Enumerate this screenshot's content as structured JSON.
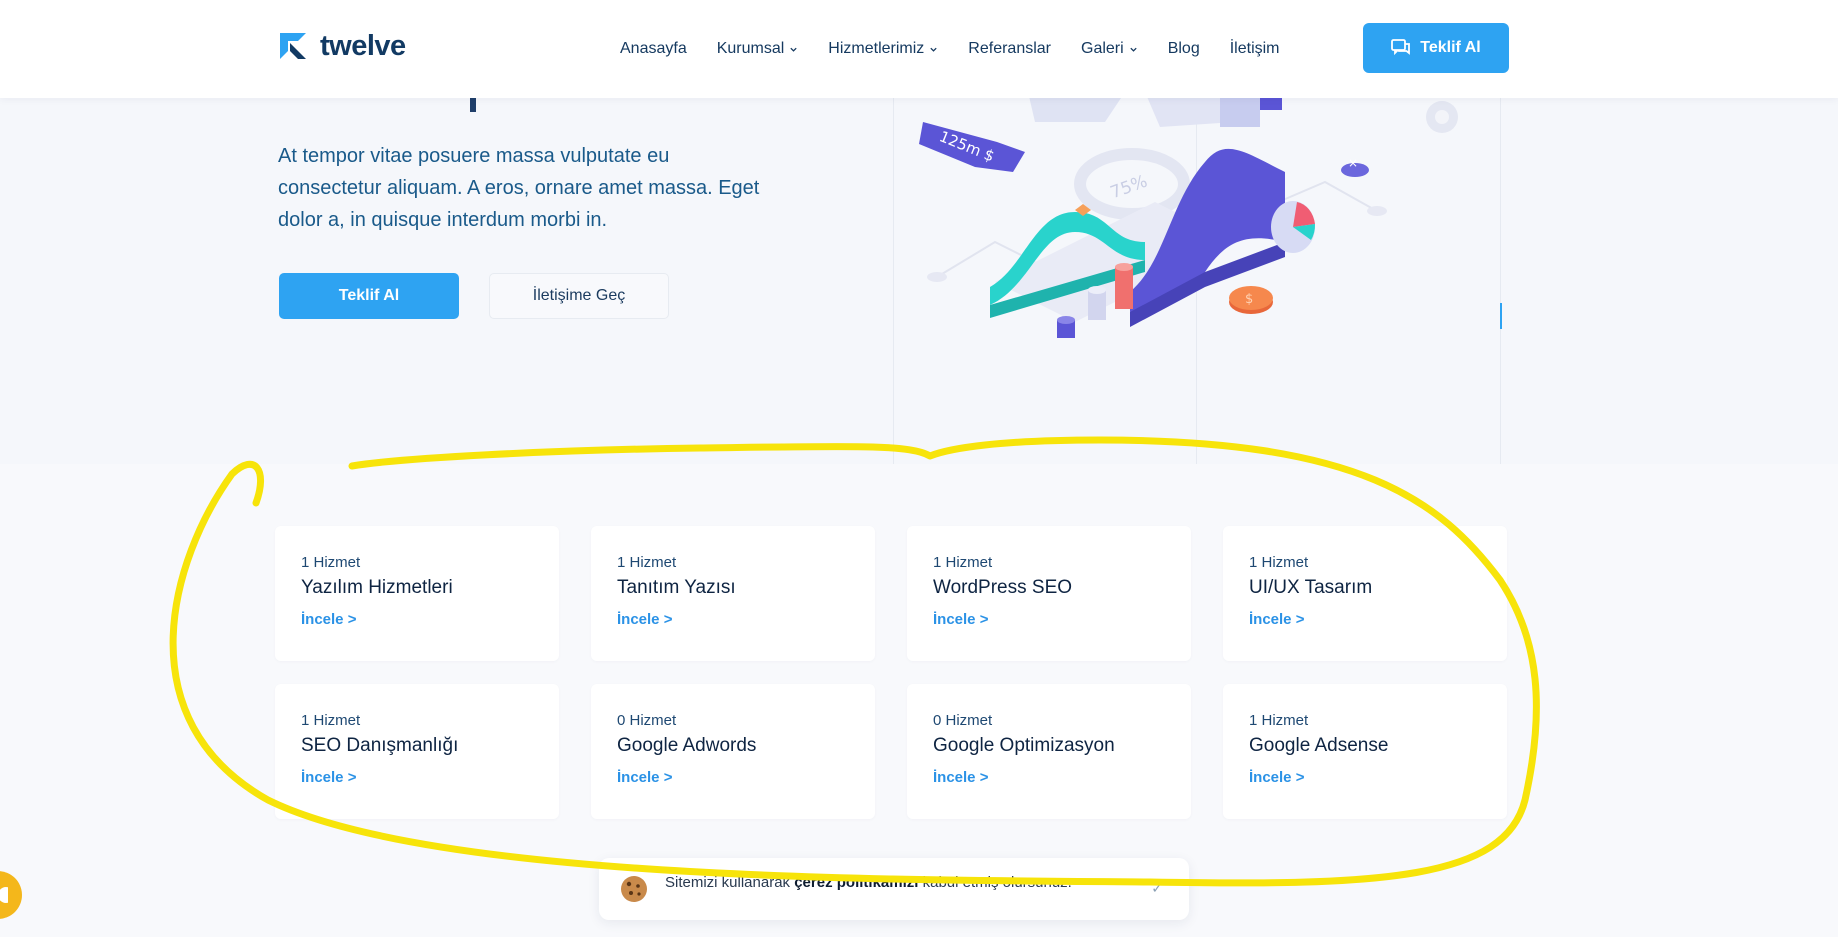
{
  "header": {
    "logo_text": "twelve",
    "nav": [
      {
        "label": "Anasayfa",
        "dropdown": false
      },
      {
        "label": "Kurumsal",
        "dropdown": true
      },
      {
        "label": "Hizmetlerimiz",
        "dropdown": true
      },
      {
        "label": "Referanslar",
        "dropdown": false
      },
      {
        "label": "Galeri",
        "dropdown": true
      },
      {
        "label": "Blog",
        "dropdown": false
      },
      {
        "label": "İletişim",
        "dropdown": false
      }
    ],
    "cta_label": "Teklif Al"
  },
  "hero": {
    "description": "At tempor vitae posuere massa vulputate eu consectetur aliquam. A eros, ornare amet massa. Eget dolor a, in quisque interdum morbi in.",
    "primary_button": "Teklif Al",
    "secondary_button": "İletişime Geç",
    "illustration": {
      "price_tag": "125m $",
      "gauge": "75%"
    }
  },
  "categories": [
    {
      "count": "1 Hizmet",
      "title": "Yazılım Hizmetleri",
      "link": "İncele >"
    },
    {
      "count": "1 Hizmet",
      "title": "Tanıtım Yazısı",
      "link": "İncele >"
    },
    {
      "count": "1 Hizmet",
      "title": "WordPress SEO",
      "link": "İncele >"
    },
    {
      "count": "1 Hizmet",
      "title": "UI/UX Tasarım",
      "link": "İncele >"
    },
    {
      "count": "1 Hizmet",
      "title": "SEO Danışmanlığı",
      "link": "İncele >"
    },
    {
      "count": "0 Hizmet",
      "title": "Google Adwords",
      "link": "İncele >"
    },
    {
      "count": "0 Hizmet",
      "title": "Google Optimizasyon",
      "link": "İncele >"
    },
    {
      "count": "1 Hizmet",
      "title": "Google Adsense",
      "link": "İncele >"
    }
  ],
  "cookie": {
    "text_before": "Sitemizi kullanarak",
    "text_bold": "çerez politikamızı",
    "text_after": "kabul etmiş olursunuz.",
    "close": "✓"
  },
  "colors": {
    "accent": "#2ea3f2",
    "annotation": "#f7e40a",
    "chat": "#f4b71b"
  },
  "icons": {
    "logo": "twelve-logo-icon",
    "cta": "chat-bubbles-icon",
    "cookie": "cookie-icon",
    "chat": "chat-icon"
  }
}
